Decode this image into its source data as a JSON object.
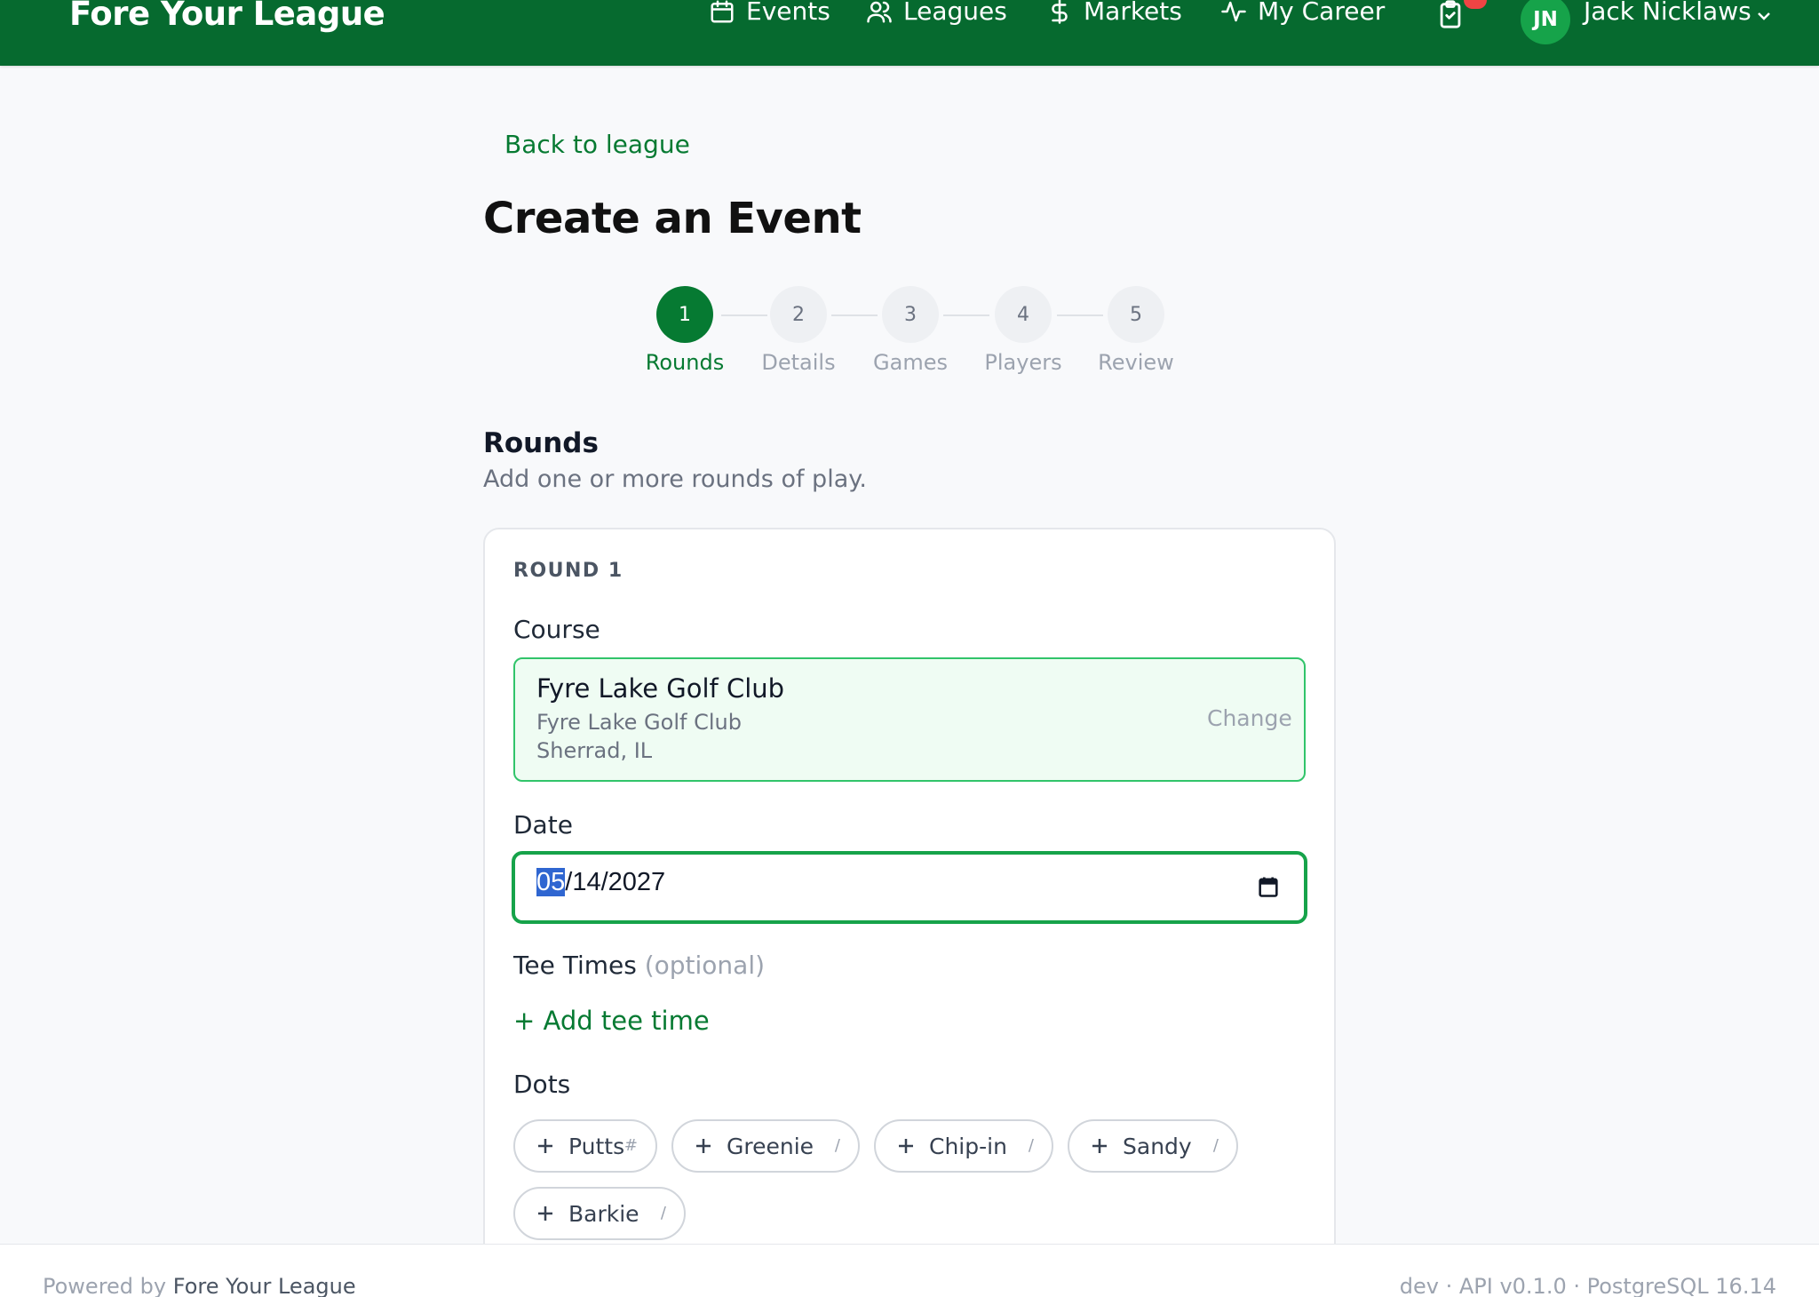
{
  "app": {
    "title": "Fore Your League"
  },
  "nav": {
    "items": [
      {
        "label": "Events",
        "icon": "calendar-icon"
      },
      {
        "label": "Leagues",
        "icon": "users-icon"
      },
      {
        "label": "Markets",
        "icon": "dollar-icon"
      },
      {
        "label": "My Career",
        "icon": "activity-icon"
      }
    ],
    "tasks_icon": "clipboard-check-icon"
  },
  "user": {
    "initials": "JN",
    "name": "Jack Nicklaws"
  },
  "page": {
    "back_label": "Back to league",
    "title": "Create an Event"
  },
  "steps": [
    {
      "number": "1",
      "label": "Rounds",
      "active": true
    },
    {
      "number": "2",
      "label": "Details",
      "active": false
    },
    {
      "number": "3",
      "label": "Games",
      "active": false
    },
    {
      "number": "4",
      "label": "Players",
      "active": false
    },
    {
      "number": "5",
      "label": "Review",
      "active": false
    }
  ],
  "section": {
    "title": "Rounds",
    "subtitle": "Add one or more rounds of play."
  },
  "round": {
    "label": "ROUND 1",
    "course_label": "Course",
    "course": {
      "name": "Fyre Lake Golf Club",
      "club": "Fyre Lake Golf Club",
      "location": "Sherrad, IL",
      "change_label": "Change"
    },
    "date_label": "Date",
    "date": {
      "month": "05",
      "rest": "/14/2027"
    },
    "tee_label": "Tee Times",
    "tee_optional": "(optional)",
    "add_tee_label": "+ Add tee time",
    "dots_label": "Dots",
    "dots": [
      {
        "label": "Putts",
        "suffix": "#"
      },
      {
        "label": "Greenie",
        "suffix": "/"
      },
      {
        "label": "Chip-in",
        "suffix": "/"
      },
      {
        "label": "Sandy",
        "suffix": "/"
      },
      {
        "label": "Barkie",
        "suffix": "/"
      }
    ]
  },
  "footer": {
    "powered_by": "Powered by",
    "brand": "Fore Your League",
    "version": "dev · API v0.1.0 · PostgreSQL 16.14"
  },
  "colors": {
    "brand_green": "#066a2f",
    "accent_green": "#067a32",
    "focus_green": "#16a34a",
    "notification_red": "#ef4444"
  }
}
